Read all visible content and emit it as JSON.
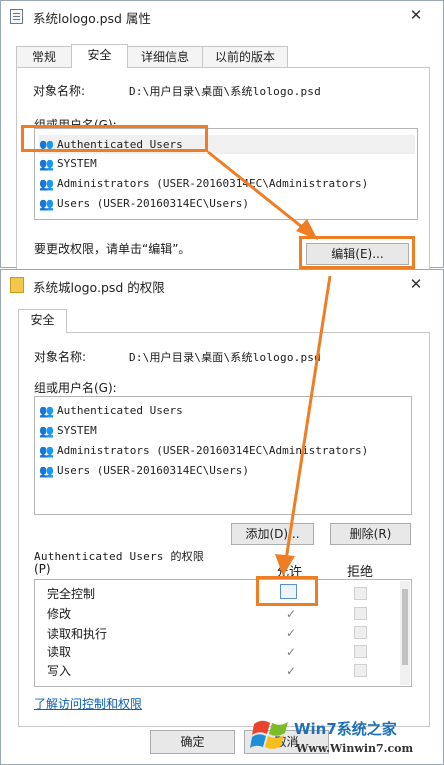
{
  "properties_window": {
    "title": "系统lologo.psd 属性",
    "tabs": [
      "常规",
      "安全",
      "详细信息",
      "以前的版本"
    ],
    "object_label": "对象名称:",
    "object_value": "D:\\用户目录\\桌面\\系统lologo.psd",
    "group_label": "组或用户名(G):",
    "users": [
      "Authenticated Users",
      "SYSTEM",
      "Administrators (USER-20160314EC\\Administrators)",
      "Users (USER-20160314EC\\Users)"
    ],
    "edit_hint": "要更改权限，请单击“编辑”。",
    "edit_button": "编辑(E)..."
  },
  "permissions_window": {
    "title": "系统城logo.psd 的权限",
    "tab": "安全",
    "object_label": "对象名称:",
    "object_value": "D:\\用户目录\\桌面\\系统lologo.psd",
    "group_label": "组或用户名(G):",
    "users": [
      "Authenticated Users",
      "SYSTEM",
      "Administrators (USER-20160314EC\\Administrators)",
      "Users (USER-20160314EC\\Users)"
    ],
    "add_button": "添加(D)...",
    "remove_button": "删除(R)",
    "perm_header_line1": "Authenticated Users 的权限",
    "perm_header_line2": "(P)",
    "allow_header": "允许",
    "deny_header": "拒绝",
    "permissions": [
      {
        "name": "完全控制",
        "allow": true,
        "deny": false
      },
      {
        "name": "修改",
        "allow": true,
        "deny": false
      },
      {
        "name": "读取和执行",
        "allow": true,
        "deny": false
      },
      {
        "name": "读取",
        "allow": true,
        "deny": false
      },
      {
        "name": "写入",
        "allow": true,
        "deny": false
      }
    ],
    "learn_link": "了解访问控制和权限",
    "ok_button": "确定",
    "cancel_button": "取消"
  },
  "watermark": {
    "brand": "Win7系统之家",
    "url": "Www.Winwin7.com"
  },
  "colors": {
    "highlight": "#ee7d23",
    "link": "#0b5fb4"
  }
}
